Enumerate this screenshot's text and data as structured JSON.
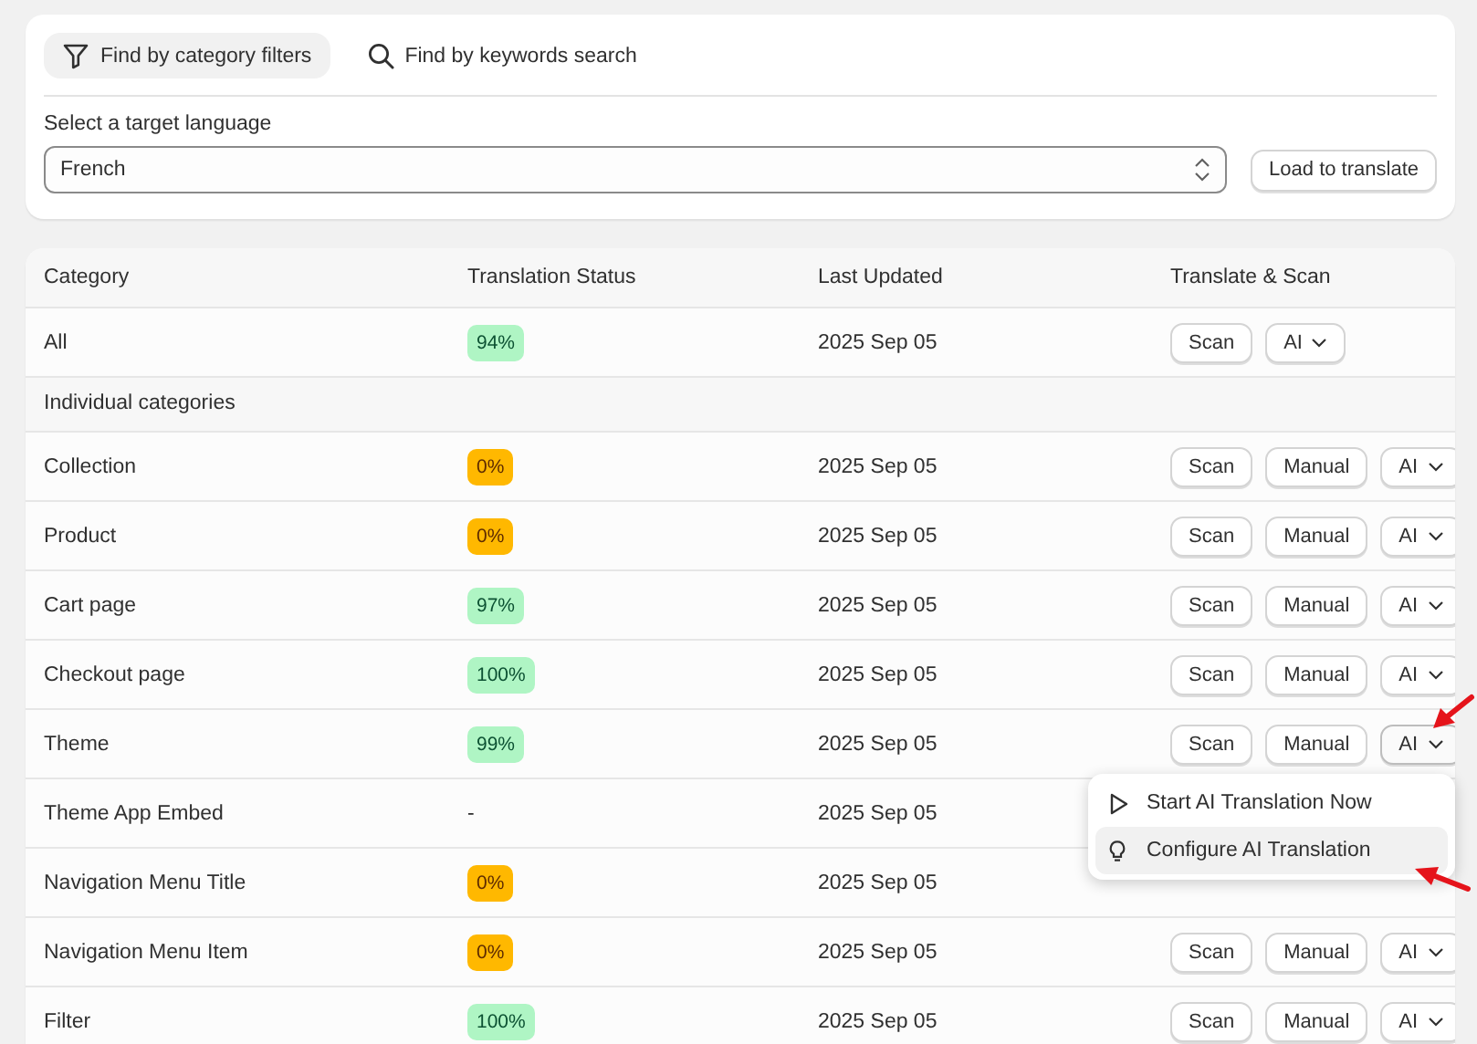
{
  "search_tabs": [
    {
      "label": "Find by category filters",
      "selected": true
    },
    {
      "label": "Find by keywords search",
      "selected": false
    }
  ],
  "language": {
    "label": "Select a target language",
    "value": "French",
    "button": "Load to translate"
  },
  "table": {
    "columns": [
      "Category",
      "Translation Status",
      "Last Updated",
      "Translate & Scan"
    ],
    "rows": [
      {
        "kind": "row",
        "category": "All",
        "status": "94%",
        "color": "#aff5c4",
        "updated": "2025 Sep 05",
        "actions": [
          {
            "label": "Scan",
            "kind": "button"
          },
          {
            "label": "AI",
            "kind": "dropdown",
            "expanded": false
          }
        ]
      },
      {
        "kind": "section",
        "category": "Individual categories"
      },
      {
        "kind": "row",
        "category": "Collection",
        "status": "0%",
        "color": "#ffb800",
        "updated": "2025 Sep 05",
        "actions": [
          {
            "label": "Scan",
            "kind": "button"
          },
          {
            "label": "Manual",
            "kind": "button"
          },
          {
            "label": "AI",
            "kind": "dropdown",
            "expanded": false
          }
        ]
      },
      {
        "kind": "row",
        "category": "Product",
        "status": "0%",
        "color": "#ffb800",
        "updated": "2025 Sep 05",
        "actions": [
          {
            "label": "Scan",
            "kind": "button"
          },
          {
            "label": "Manual",
            "kind": "button"
          },
          {
            "label": "AI",
            "kind": "dropdown",
            "expanded": false
          }
        ]
      },
      {
        "kind": "row",
        "category": "Cart page",
        "status": "97%",
        "color": "#aff5c4",
        "updated": "2025 Sep 05",
        "actions": [
          {
            "label": "Scan",
            "kind": "button"
          },
          {
            "label": "Manual",
            "kind": "button"
          },
          {
            "label": "AI",
            "kind": "dropdown",
            "expanded": false
          }
        ]
      },
      {
        "kind": "row",
        "category": "Checkout page",
        "status": "100%",
        "color": "#aff5c4",
        "updated": "2025 Sep 05",
        "actions": [
          {
            "label": "Scan",
            "kind": "button"
          },
          {
            "label": "Manual",
            "kind": "button"
          },
          {
            "label": "AI",
            "kind": "dropdown",
            "expanded": false
          }
        ]
      },
      {
        "kind": "row",
        "category": "Theme",
        "status": "99%",
        "color": "#aff5c4",
        "updated": "2025 Sep 05",
        "actions": [
          {
            "label": "Scan",
            "kind": "button"
          },
          {
            "label": "Manual",
            "kind": "button"
          },
          {
            "label": "AI",
            "kind": "dropdown",
            "expanded": true
          }
        ]
      },
      {
        "kind": "row",
        "category": "Theme App Embed",
        "status": "-",
        "updated": "2025 Sep 05"
      },
      {
        "kind": "row",
        "category": "Navigation Menu Title",
        "status": "0%",
        "color": "#ffb800",
        "updated": "2025 Sep 05"
      },
      {
        "kind": "row",
        "category": "Navigation Menu Item",
        "status": "0%",
        "color": "#ffb800",
        "updated": "2025 Sep 05",
        "actions": [
          {
            "label": "Scan",
            "kind": "button"
          },
          {
            "label": "Manual",
            "kind": "button"
          },
          {
            "label": "AI",
            "kind": "dropdown",
            "expanded": false
          }
        ]
      },
      {
        "kind": "row",
        "category": "Filter",
        "status": "100%",
        "color": "#aff5c4",
        "updated": "2025 Sep 05",
        "actions": [
          {
            "label": "Scan",
            "kind": "button"
          },
          {
            "label": "Manual",
            "kind": "button"
          },
          {
            "label": "AI",
            "kind": "dropdown",
            "expanded": false
          }
        ]
      }
    ]
  },
  "ai_menu": [
    {
      "label": "Start AI Translation Now",
      "selected": false
    },
    {
      "label": "Configure AI Translation",
      "selected": true
    }
  ]
}
